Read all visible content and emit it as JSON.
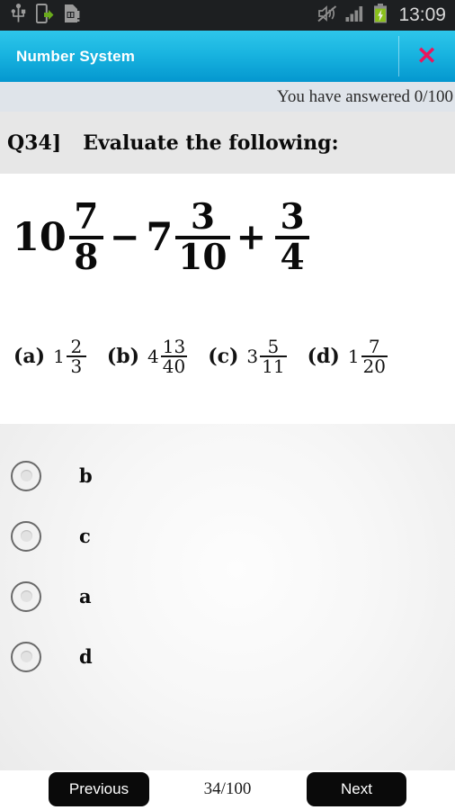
{
  "statusbar": {
    "time": "13:09",
    "left_icons": [
      {
        "name": "usb-icon",
        "label": "USB"
      },
      {
        "name": "phone-transfer-icon",
        "label": "USB transfer"
      },
      {
        "name": "sim-card-alert-icon",
        "label": "SIM card"
      }
    ],
    "right_icons": [
      {
        "name": "sound-mute-icon",
        "label": "Mute"
      },
      {
        "name": "signal-bars-icon",
        "label": "Signal"
      },
      {
        "name": "battery-charging-icon",
        "label": "Battery charging"
      }
    ],
    "battery_color": "#8ac01a"
  },
  "titlebar": {
    "title": "Number System",
    "close_label": "✕",
    "accent_start": "#2ec6ea",
    "accent_end": "#0497cf",
    "close_color": "#e8175d"
  },
  "status": {
    "answered_text": "You have answered 0/100"
  },
  "question": {
    "number_label": "Q34]",
    "prompt": "Evaluate the following:",
    "expression": {
      "term1": {
        "whole": "10",
        "num": "7",
        "den": "8"
      },
      "op1": "−",
      "term2": {
        "whole": "7",
        "num": "3",
        "den": "10"
      },
      "op2": "+",
      "term3": {
        "whole": "",
        "num": "3",
        "den": "4"
      }
    },
    "choices": [
      {
        "tag": "(a)",
        "whole": "1",
        "num": "2",
        "den": "3"
      },
      {
        "tag": "(b)",
        "whole": "4",
        "num": "13",
        "den": "40"
      },
      {
        "tag": "(c)",
        "whole": "3",
        "num": "5",
        "den": "11"
      },
      {
        "tag": "(d)",
        "whole": "1",
        "num": "7",
        "den": "20"
      }
    ]
  },
  "answers": {
    "options": [
      {
        "label": "b",
        "selected": false
      },
      {
        "label": "c",
        "selected": false
      },
      {
        "label": "a",
        "selected": false
      },
      {
        "label": "d",
        "selected": false
      }
    ]
  },
  "footer": {
    "previous_label": "Previous",
    "counter": "34/100",
    "next_label": "Next"
  }
}
